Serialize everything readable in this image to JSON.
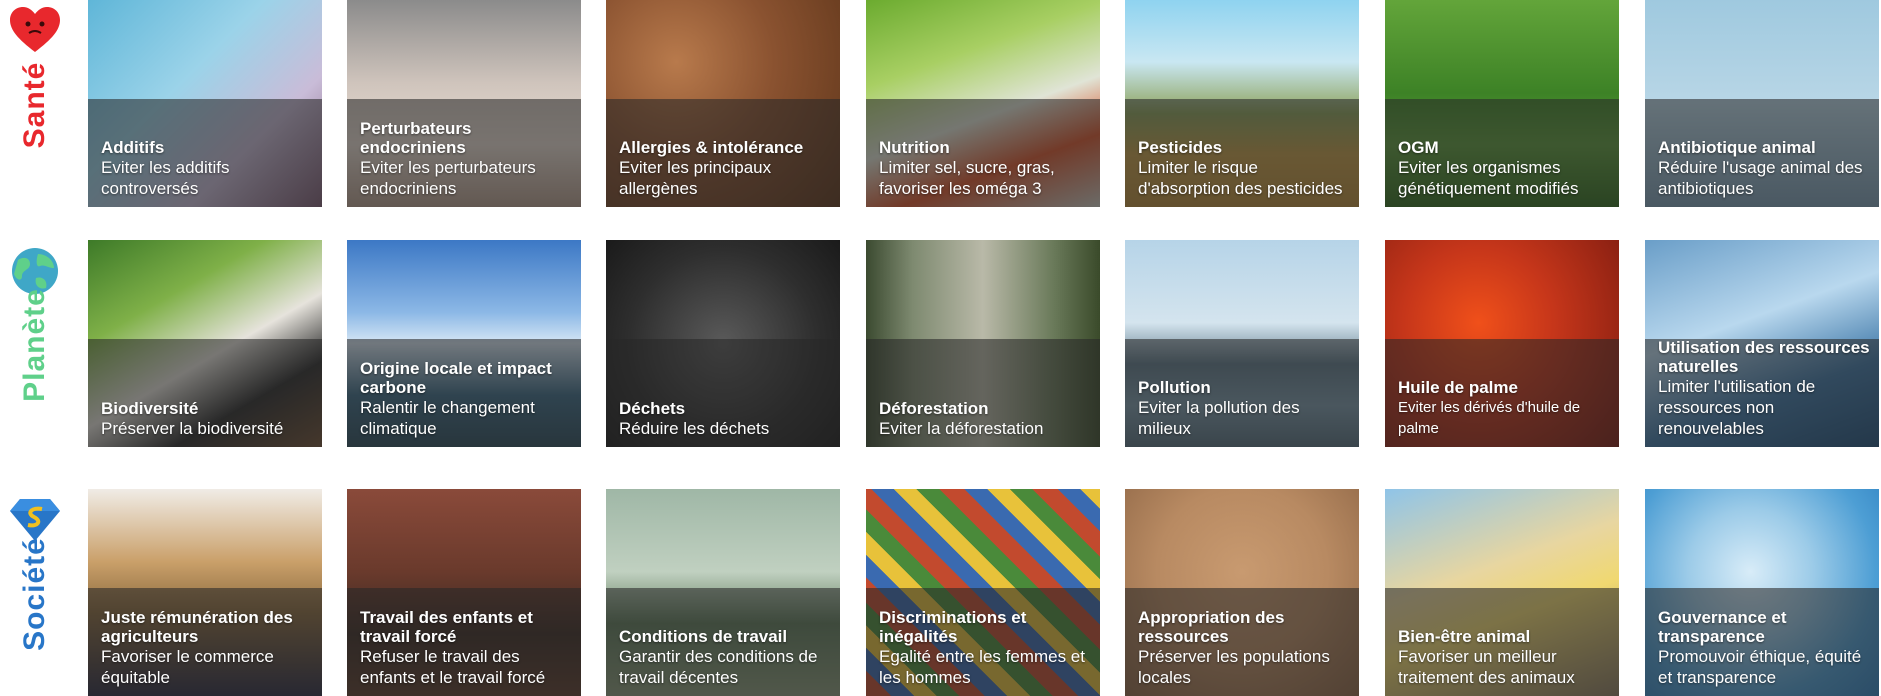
{
  "rows": [
    {
      "label": "Santé",
      "color": "#e8282d",
      "icon": "heart-icon",
      "tiles": [
        {
          "title": "Additifs",
          "desc": "Eviter les additifs controversés"
        },
        {
          "title": "Perturbateurs endocriniens",
          "desc": "Eviter les perturbateurs endocriniens"
        },
        {
          "title": "Allergies & intolérance",
          "desc": "Eviter les principaux allergènes"
        },
        {
          "title": "Nutrition",
          "desc": "Limiter sel, sucre, gras, favoriser les oméga 3"
        },
        {
          "title": "Pesticides",
          "desc": "Limiter le risque d'absorption des pesticides"
        },
        {
          "title": "OGM",
          "desc": "Eviter les organismes génétiquement modifiés"
        },
        {
          "title": "Antibiotique animal",
          "desc": "Réduire l'usage animal des antibiotiques"
        }
      ]
    },
    {
      "label": "Planète",
      "color": "#5fd08a",
      "icon": "earth-icon",
      "tiles": [
        {
          "title": "Biodiversité",
          "desc": "Préserver la biodiversité"
        },
        {
          "title": "Origine locale et impact carbone",
          "desc": "Ralentir le changement climatique"
        },
        {
          "title": "Déchets",
          "desc": "Réduire les déchets"
        },
        {
          "title": "Déforestation",
          "desc": "Eviter la déforestation"
        },
        {
          "title": "Pollution",
          "desc": "Eviter la pollution des milieux"
        },
        {
          "title": "Huile de palme",
          "desc": "Eviter les dérivés d'huile de palme"
        },
        {
          "title": "Utilisation des ressources naturelles",
          "desc": "Limiter l'utilisation de ressources non renouvelables"
        }
      ]
    },
    {
      "label": "Société",
      "color": "#2876c8",
      "icon": "superhero-emblem-icon",
      "tiles": [
        {
          "title": "Juste rémunération des agriculteurs",
          "desc": "Favoriser le commerce équitable"
        },
        {
          "title": "Travail des enfants et travail forcé",
          "desc": "Refuser le travail des enfants et le travail forcé"
        },
        {
          "title": "Conditions de travail",
          "desc": "Garantir des conditions de travail décentes"
        },
        {
          "title": "Discriminations et inégalités",
          "desc": "Egalité entre les femmes et les hommes"
        },
        {
          "title": "Appropriation des ressources",
          "desc": "Préserver les populations locales"
        },
        {
          "title": "Bien-être animal",
          "desc": "Favoriser un meilleur traitement des animaux"
        },
        {
          "title": "Gouvernance et transparence",
          "desc": "Promouvoir éthique, équité et transparence"
        }
      ]
    }
  ]
}
